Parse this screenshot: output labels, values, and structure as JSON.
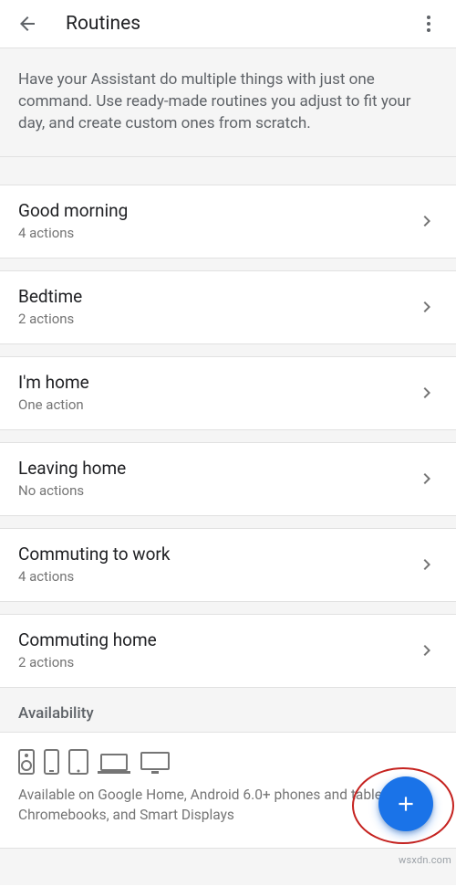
{
  "header": {
    "title": "Routines"
  },
  "intro": "Have your Assistant do multiple things with just one command. Use ready-made routines you adjust to fit your day, and create custom ones from scratch.",
  "routines": [
    {
      "title": "Good morning",
      "sub": "4 actions"
    },
    {
      "title": "Bedtime",
      "sub": "2 actions"
    },
    {
      "title": "I'm home",
      "sub": "One action"
    },
    {
      "title": "Leaving home",
      "sub": "No actions"
    },
    {
      "title": "Commuting to work",
      "sub": "4 actions"
    },
    {
      "title": "Commuting home",
      "sub": "2 actions"
    }
  ],
  "availability": {
    "heading": "Availability",
    "text": "Available on Google Home, Android 6.0+ phones and tablets, Chromebooks, and Smart Displays"
  },
  "watermark": "wsxdn.com",
  "colors": {
    "accent": "#1a73e8",
    "highlight_ring": "#c5221f"
  }
}
